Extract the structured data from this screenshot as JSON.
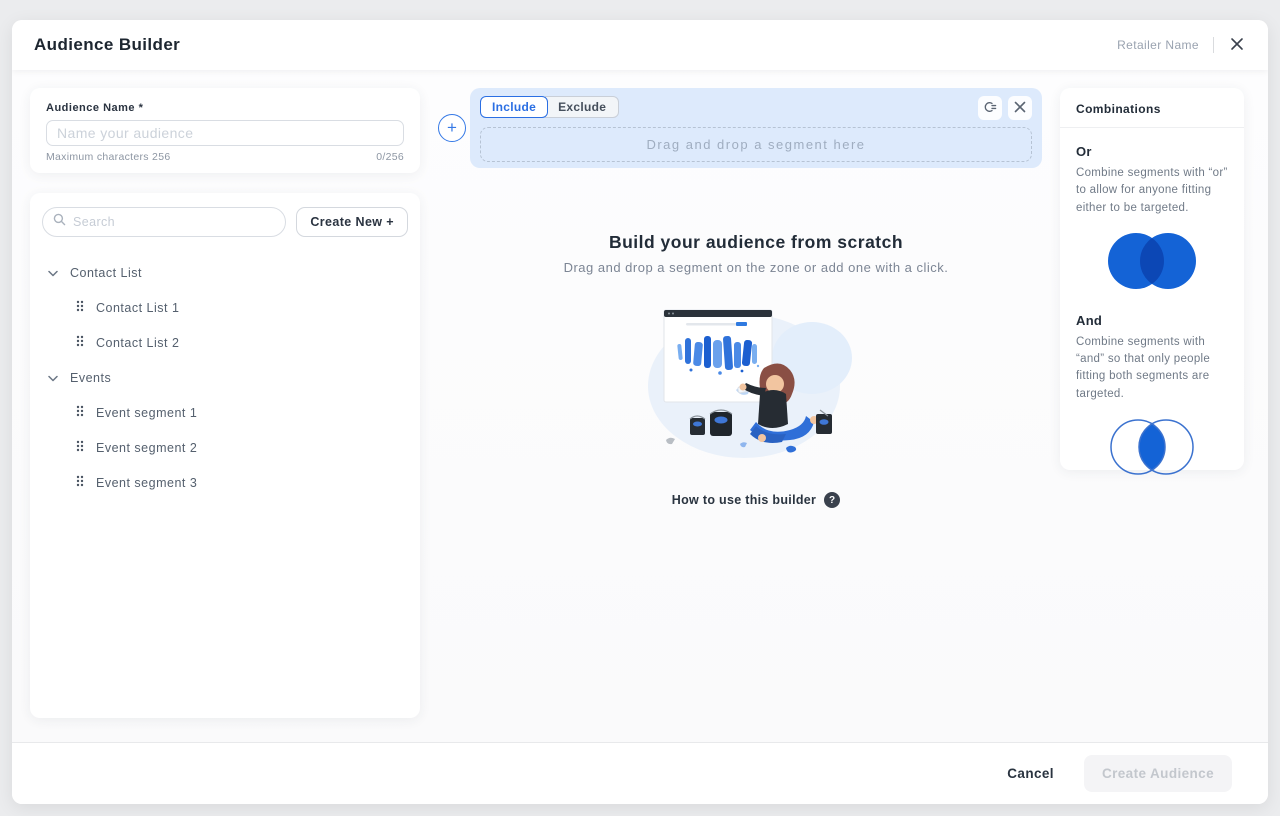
{
  "header": {
    "title": "Audience Builder",
    "retailer_name": "Retailer Name"
  },
  "audience_name_card": {
    "label": "Audience Name *",
    "placeholder": "Name your audience",
    "value": "",
    "helper": "Maximum characters 256",
    "counter": "0/256"
  },
  "segments_card": {
    "search_placeholder": "Search",
    "search_value": "",
    "create_new_label": "Create New  +",
    "groups": [
      {
        "label": "Contact List",
        "items": [
          "Contact List 1",
          "Contact List 2"
        ]
      },
      {
        "label": "Events",
        "items": [
          "Event segment 1",
          "Event segment 2",
          "Event segment 3"
        ]
      }
    ]
  },
  "builder": {
    "include_label": "Include",
    "exclude_label": "Exclude",
    "dropzone_text": "Drag and drop a segment here",
    "heading": "Build your audience from scratch",
    "subheading": "Drag and drop a segment on the zone or add one with a click.",
    "help_text": "How to use this builder",
    "help_icon": "?"
  },
  "combinations": {
    "title": "Combinations",
    "sections": [
      {
        "heading": "Or",
        "description": "Combine segments with “or” to allow for anyone fitting either to be targeted."
      },
      {
        "heading": "And",
        "description": "Combine segments with “and” so that only people fitting both segments are targeted."
      }
    ]
  },
  "footer": {
    "cancel_label": "Cancel",
    "create_label": "Create Audience"
  },
  "colors": {
    "accent_blue": "#2b6fe3",
    "panel_blue": "#ddeafc",
    "venn_fill": "#1463d6",
    "venn_overlap": "#0c47b5",
    "text_dark": "#222c38",
    "text_muted": "#707a87"
  }
}
